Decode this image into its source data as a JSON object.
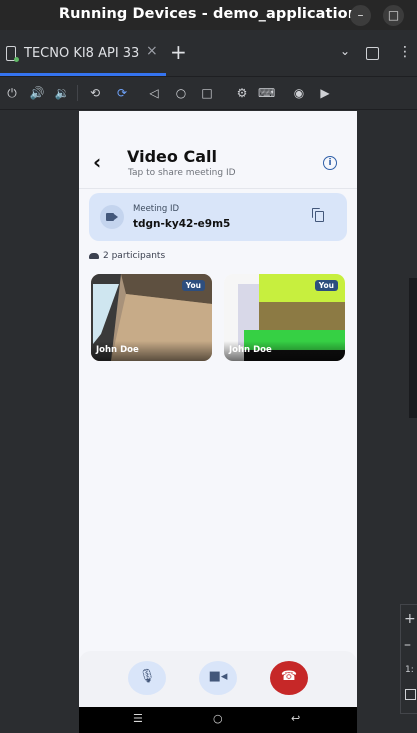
{
  "window": {
    "title": "Running Devices - demo_application"
  },
  "tabs": [
    {
      "label": "TECNO KI8 API 33"
    }
  ],
  "toolbar": {
    "icons": [
      "power-icon",
      "volume-up-icon",
      "volume-down-icon",
      "rotate-left-icon",
      "rotate-right-icon",
      "back-icon",
      "home-icon",
      "overview-icon",
      "settings-icon",
      "keyboard-icon",
      "screenshot-icon",
      "record-icon"
    ]
  },
  "app": {
    "title": "Video Call",
    "subtitle": "Tap to share meeting ID",
    "meeting": {
      "label": "Meeting ID",
      "id": "tdgn-ky42-e9m5"
    },
    "participants_label": "2 participants",
    "tiles": [
      {
        "name": "John Doe",
        "badge": "You"
      },
      {
        "name": "John Doe",
        "badge": "You"
      }
    ]
  },
  "side_panel": {
    "text": "1:"
  },
  "colors": {
    "accent": "#3574f0",
    "meeting_card": "#d9e5f9",
    "end_call": "#c62828"
  }
}
